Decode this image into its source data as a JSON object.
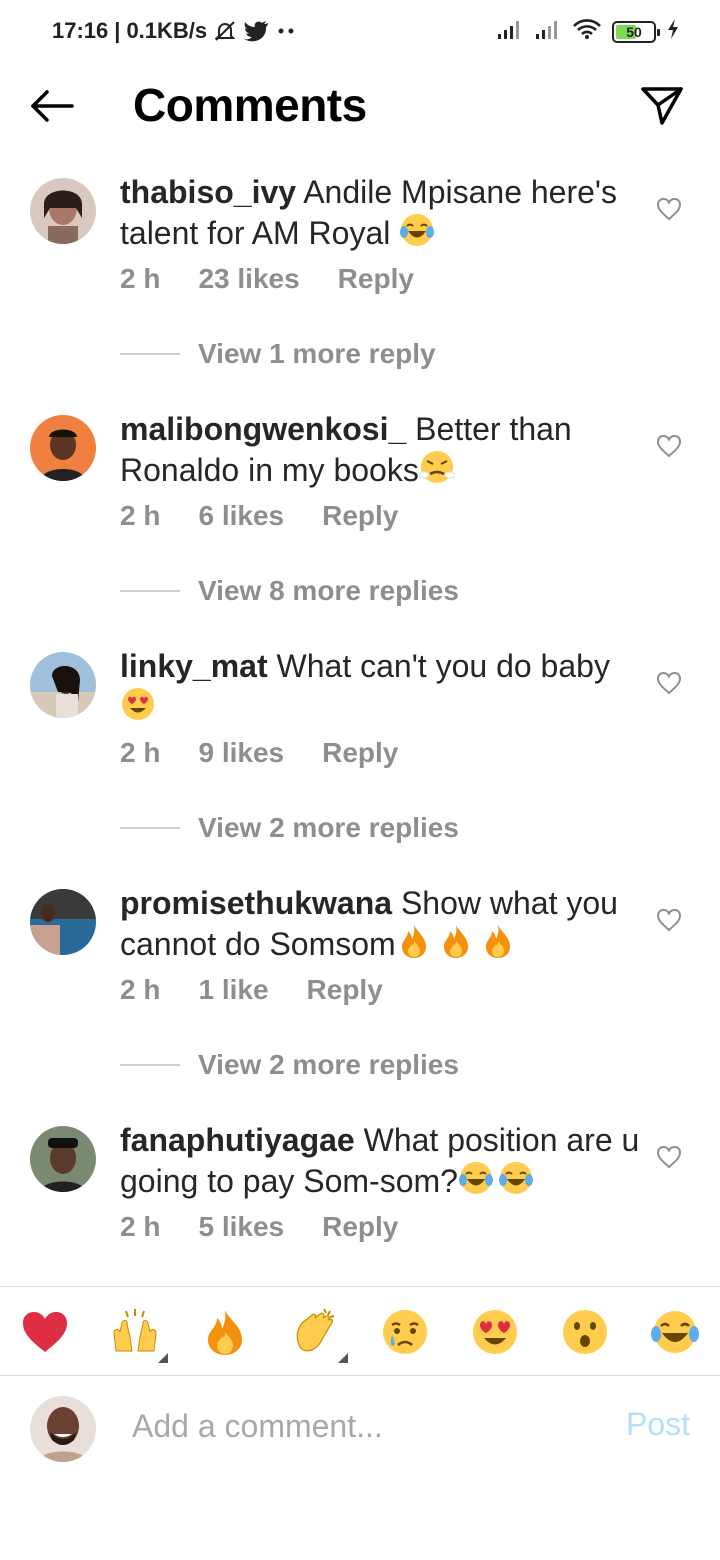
{
  "status_bar": {
    "time": "17:16",
    "speed": "0.1KB/s",
    "battery": "50",
    "icons": [
      "bell-muted-icon",
      "twitter-icon",
      "more-dots-icon",
      "signal-icon",
      "signal-icon",
      "wifi-icon",
      "battery-icon",
      "charging-icon"
    ]
  },
  "header": {
    "title": "Comments",
    "back_icon": "back-arrow-icon",
    "share_icon": "send-icon"
  },
  "comments": [
    {
      "username": "thabiso_ivy",
      "text": "Andile Mpisane here's talent for AM Royal",
      "emojis": [
        "laughing-tears"
      ],
      "time": "2 h",
      "likes": "23 likes",
      "reply": "Reply",
      "view_replies": "View 1 more reply",
      "avatar_color": "#a89088"
    },
    {
      "username": "malibongwenkosi_",
      "text": "Better than Ronaldo in my books",
      "emojis": [
        "triumph"
      ],
      "time": "2 h",
      "likes": "6 likes",
      "reply": "Reply",
      "view_replies": "View 8 more replies",
      "avatar_color": "#f08040"
    },
    {
      "username": "linky_mat",
      "text": "What can't you do baby",
      "emojis": [
        "heart-eyes"
      ],
      "time": "2 h",
      "likes": "9 likes",
      "reply": "Reply",
      "view_replies": "View 2 more replies",
      "avatar_color": "#6a8aa8"
    },
    {
      "username": "promisethukwana",
      "text": "Show what you cannot do Somsom",
      "emojis": [
        "fire",
        "fire",
        "fire"
      ],
      "time": "2 h",
      "likes": "1 like",
      "reply": "Reply",
      "view_replies": "View 2 more replies",
      "avatar_color": "#3f7fa8"
    },
    {
      "username": "fanaphutiyagae",
      "text": "What position are u going to pay Som-som?",
      "emojis": [
        "laughing-tears",
        "laughing-tears"
      ],
      "time": "2 h",
      "likes": "5 likes",
      "reply": "Reply",
      "view_replies": "",
      "avatar_color": "#4a5a48"
    }
  ],
  "emoji_bar": [
    "red-heart",
    "raising-hands",
    "fire",
    "clapping-hands",
    "crying-face",
    "heart-eyes",
    "open-mouth-face",
    "laughing-tears"
  ],
  "composer": {
    "placeholder": "Add a comment...",
    "post_label": "Post",
    "avatar_color": "#8a6a58"
  },
  "colors": {
    "text": "#262626",
    "secondary": "#8e8e8e",
    "post_disabled": "#b2dffc"
  }
}
